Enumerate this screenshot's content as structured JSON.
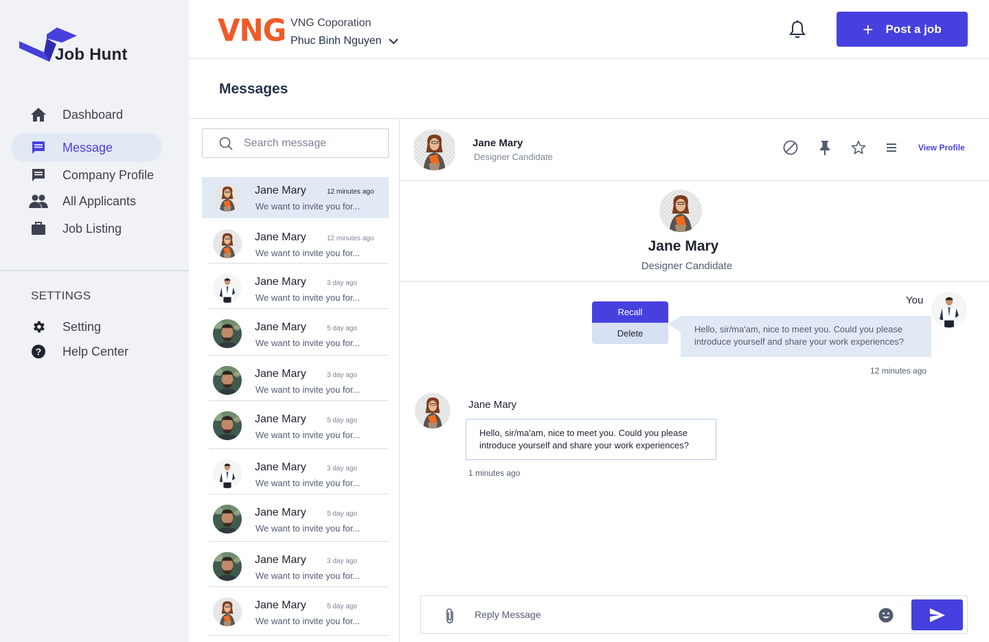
{
  "brand": {
    "name": "Job Hunt",
    "accent": "#4640DE"
  },
  "sidebar": {
    "items": [
      {
        "label": "Dashboard",
        "icon": "home-icon"
      },
      {
        "label": "Message",
        "icon": "message-icon",
        "active": true
      },
      {
        "label": "Company Profile",
        "icon": "company-icon"
      },
      {
        "label": "All Applicants",
        "icon": "people-icon"
      },
      {
        "label": "Job Listing",
        "icon": "briefcase-icon"
      }
    ],
    "settings_title": "SETTINGS",
    "settings_items": [
      {
        "label": "Setting",
        "icon": "gear-icon"
      },
      {
        "label": "Help Center",
        "icon": "help-icon"
      }
    ]
  },
  "header": {
    "company_logo": "VNG",
    "company_name": "VNG Coporation",
    "user_name": "Phuc Binh Nguyen",
    "post_button": "Post a job"
  },
  "page": {
    "title": "Messages"
  },
  "search": {
    "placeholder": "Search message"
  },
  "conversations": [
    {
      "name": "Jane Mary",
      "time": "12 minutes ago",
      "preview": "We want to invite you for...",
      "avatar": "woman",
      "active": true
    },
    {
      "name": "Jane Mary",
      "time": "12 minutes ago",
      "preview": "We want to invite you for...",
      "avatar": "woman"
    },
    {
      "name": "Jane Mary",
      "time": "3 day ago",
      "preview": "We want to invite you for...",
      "avatar": "suit-man"
    },
    {
      "name": "Jane Mary",
      "time": "5 day ago",
      "preview": "We want to invite you for...",
      "avatar": "bearded-man"
    },
    {
      "name": "Jane Mary",
      "time": "3 day ago",
      "preview": "We want to invite you for...",
      "avatar": "bearded-man"
    },
    {
      "name": "Jane Mary",
      "time": "5 day ago",
      "preview": "We want to invite you for...",
      "avatar": "bearded-man"
    },
    {
      "name": "Jane Mary",
      "time": "3 day ago",
      "preview": "We want to invite you for...",
      "avatar": "suit-man"
    },
    {
      "name": "Jane Mary",
      "time": "5 day ago",
      "preview": "We want to invite you for...",
      "avatar": "bearded-man"
    },
    {
      "name": "Jane Mary",
      "time": "3 day ago",
      "preview": "We want to invite you for...",
      "avatar": "bearded-man"
    },
    {
      "name": "Jane Mary",
      "time": "5 day ago",
      "preview": "We want to invite you for...",
      "avatar": "woman"
    }
  ],
  "chat": {
    "contact_name": "Jane Mary",
    "contact_role": "Designer Candidate",
    "view_profile": "View Profile",
    "profile_name": "Jane Mary",
    "profile_role": "Designer Candidate",
    "you_label": "You",
    "menu_recall": "Recall",
    "menu_delete": "Delete",
    "my_message": "Hello, sir/ma'am, nice to meet you. Could you please introduce yourself and share your work experiences?",
    "my_time": "12 minutes ago",
    "their_name": "Jane Mary",
    "their_message": "Hello, sir/ma'am, nice to meet you. Could you please introduce yourself and share your work experiences?",
    "their_time": "1 minutes ago",
    "reply_placeholder": "Reply Message"
  }
}
